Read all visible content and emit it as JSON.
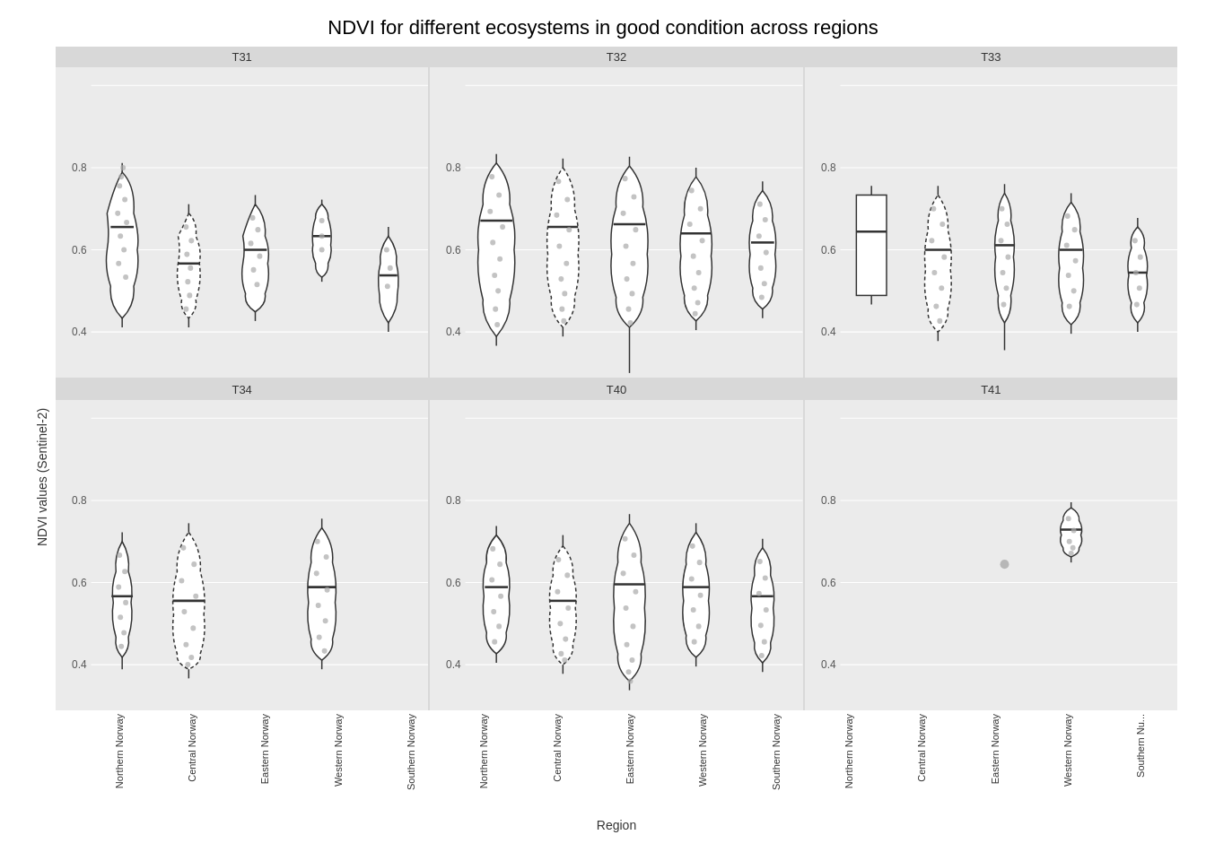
{
  "title": "NDVI for different ecosystems in good condition across regions",
  "yAxisLabel": "NDVI values (Sentinel-2)",
  "xAxisTitle": "Region",
  "panels": [
    {
      "id": "T31",
      "row": 0,
      "col": 0
    },
    {
      "id": "T32",
      "row": 0,
      "col": 1
    },
    {
      "id": "T33",
      "row": 0,
      "col": 2
    },
    {
      "id": "T34",
      "row": 1,
      "col": 0
    },
    {
      "id": "T40",
      "row": 1,
      "col": 1
    },
    {
      "id": "T41",
      "row": 1,
      "col": 2
    }
  ],
  "xLabels": [
    "Northern Norway",
    "Central Norway",
    "Eastern Norway",
    "Western Norway",
    "Southern Norway"
  ],
  "yTicks": [
    "0.4",
    "0.6",
    "0.8"
  ],
  "accentColor": "#333333",
  "bgColor": "#ebebeb",
  "panelHeaderBg": "#d8d8d8"
}
